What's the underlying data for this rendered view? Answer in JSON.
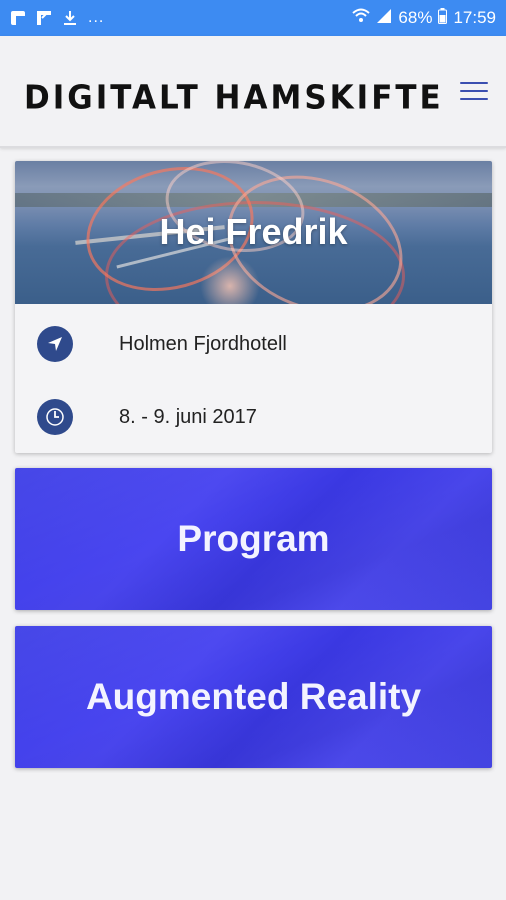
{
  "status_bar": {
    "notifications": [
      "photos-icon",
      "flipboard-icon",
      "download-icon"
    ],
    "more": "...",
    "battery": "68%",
    "time": "17:59"
  },
  "header": {
    "brand": "DIGITALT HAMSKIFTE",
    "menu_icon": "hamburger-menu-icon"
  },
  "event": {
    "greeting": "Hei Fredrik",
    "location": "Holmen Fjordhotell",
    "dates": "8. - 9. juni 2017"
  },
  "actions": [
    {
      "label": "Program"
    },
    {
      "label": "Augmented Reality"
    }
  ],
  "colors": {
    "status_bar": "#3d8bf2",
    "icon_circle": "#2f4a8c",
    "button": "#4040e8"
  }
}
